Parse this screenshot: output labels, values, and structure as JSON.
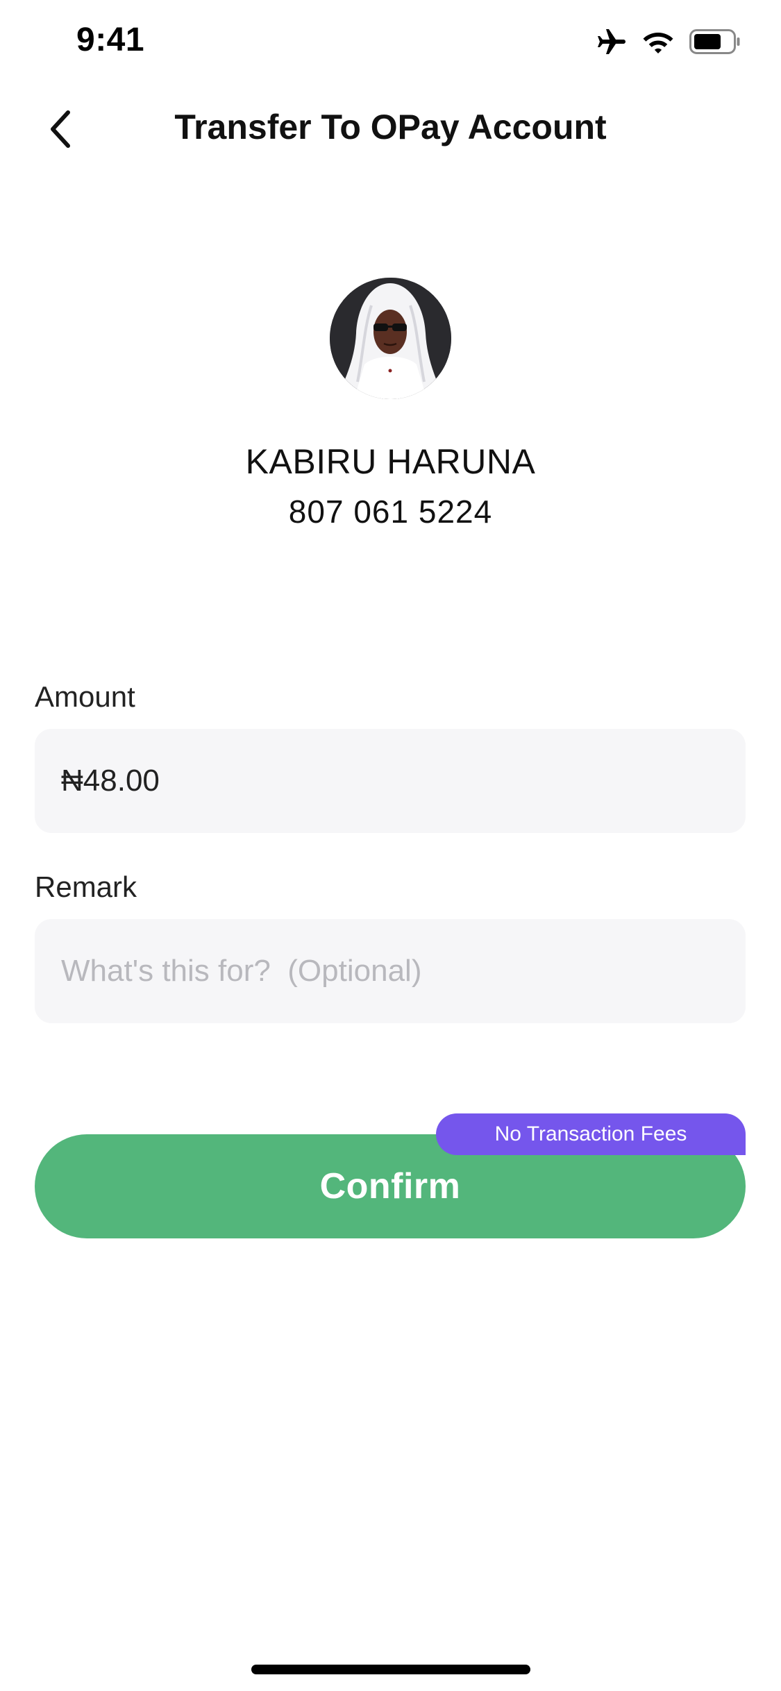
{
  "status_bar": {
    "time": "9:41",
    "icons": [
      "airplane-icon",
      "wifi-icon",
      "battery-icon"
    ]
  },
  "header": {
    "title": "Transfer To OPay Account",
    "back_icon": "chevron-left-icon"
  },
  "recipient": {
    "name": "KABIRU HARUNA",
    "phone": "807 061 5224"
  },
  "form": {
    "amount": {
      "label": "Amount",
      "value": "₦48.00"
    },
    "remark": {
      "label": "Remark",
      "value": "",
      "placeholder": "What's this for?  (Optional)"
    }
  },
  "confirm": {
    "label": "Confirm",
    "badge": "No Transaction Fees"
  },
  "colors": {
    "confirm_green": "#53b67b",
    "badge_purple": "#7556ec",
    "field_background": "#f6f6f8",
    "placeholder_gray": "#b8b8bd"
  }
}
